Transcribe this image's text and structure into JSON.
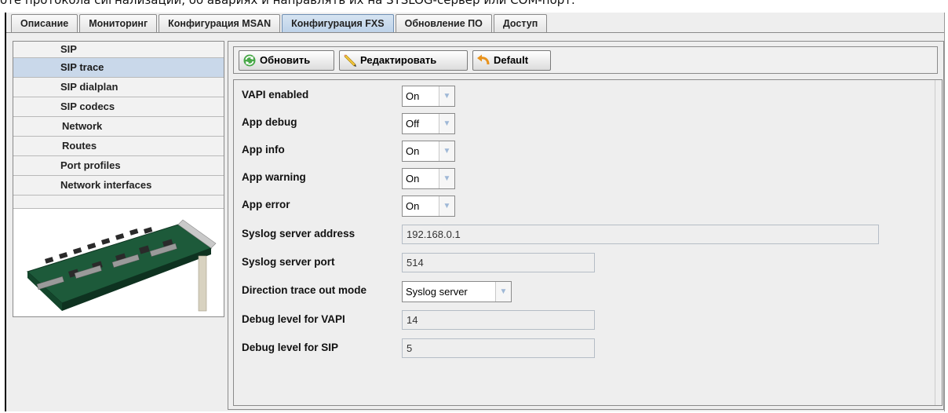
{
  "caption": "оте протокола сигнализации, об авариях и направлять их на SYSLOG-сервер или COM-порт.",
  "tabs": [
    {
      "label": "Описание"
    },
    {
      "label": "Мониторинг"
    },
    {
      "label": "Конфигурация MSAN"
    },
    {
      "label": "Конфигурация FXS",
      "active": true
    },
    {
      "label": "Обновление ПО"
    },
    {
      "label": "Доступ"
    }
  ],
  "nav": [
    {
      "label": "SIP"
    },
    {
      "label": "SIP trace",
      "active": true
    },
    {
      "label": "SIP dialplan"
    },
    {
      "label": "SIP codecs"
    },
    {
      "label": "Network"
    },
    {
      "label": "Routes"
    },
    {
      "label": "Port profiles"
    },
    {
      "label": "Network interfaces"
    }
  ],
  "toolbar": {
    "refresh_label": "Обновить",
    "edit_label": "Редактировать",
    "default_label": "Default"
  },
  "form": {
    "vapi_enabled": {
      "label": "VAPI enabled",
      "value": "On"
    },
    "app_debug": {
      "label": "App debug",
      "value": "Off"
    },
    "app_info": {
      "label": "App info",
      "value": "On"
    },
    "app_warning": {
      "label": "App warning",
      "value": "On"
    },
    "app_error": {
      "label": "App error",
      "value": "On"
    },
    "syslog_address": {
      "label": "Syslog server address",
      "value": "192.168.0.1"
    },
    "syslog_port": {
      "label": "Syslog server port",
      "value": "514"
    },
    "trace_mode": {
      "label": "Direction trace out mode",
      "value": "Syslog server"
    },
    "debug_vapi": {
      "label": "Debug level for VAPI",
      "value": "14"
    },
    "debug_sip": {
      "label": "Debug level for SIP",
      "value": "5"
    }
  },
  "colors": {
    "active_tab": "#bcd1e8",
    "active_nav": "#c9d8ea",
    "arrow": "#9fb8d6"
  },
  "icons": {
    "refresh": "refresh-icon",
    "edit": "pencil-icon",
    "default": "undo-icon",
    "dropdown": "chevron-down-icon"
  }
}
